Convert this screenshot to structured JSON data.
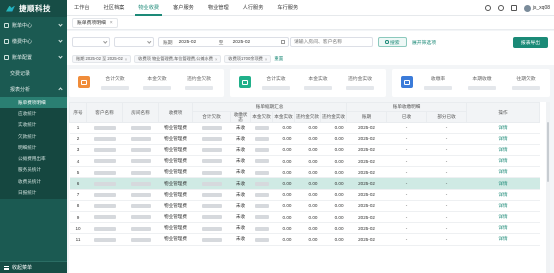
{
  "brand": {
    "name": "捷顺科技"
  },
  "sidebar": {
    "items": [
      {
        "label": "账单中心",
        "icon": "bill-icon"
      },
      {
        "label": "缴费中心",
        "icon": "payment-icon"
      },
      {
        "label": "账单配置",
        "icon": "config-icon"
      },
      {
        "label": "交费记录",
        "icon": "record-icon"
      },
      {
        "label": "报表分析",
        "icon": "report-icon"
      }
    ],
    "sub_items": [
      "账单费项明细",
      "应收统计",
      "实收统计",
      "欠款统计",
      "明细统计",
      "公摊费用出率",
      "服务员统计",
      "收费员统计",
      "日报统计"
    ],
    "footer": "收起菜单"
  },
  "topnav": {
    "tabs": [
      "工作台",
      "社区档案",
      "物业收费",
      "客户服务",
      "物业管理",
      "人行服务",
      "车行服务"
    ],
    "active": "物业收费",
    "user": "js_xq08"
  },
  "pagetab": {
    "label": "账单费项明细"
  },
  "filter": {
    "select1": "",
    "date_label": "账期",
    "date_from": "2025-02",
    "date_sep": "至",
    "date_to": "2025-02",
    "search_placeholder": "请输入房间、客户名称",
    "search_label": "搜索",
    "toggle_label": "展开筛选项",
    "export_label": "报表导出"
  },
  "chips": [
    "账期 2025-02 至 2025-02",
    "收费项 物业管理费,车位管理费,公摊水费",
    "收费项1700余项费"
  ],
  "chips_clear": "重置",
  "cards": [
    {
      "icon": "receivable-icon",
      "color": "#f08c3a",
      "stats": [
        "合计欠款",
        "本金欠款",
        "违约金欠款"
      ]
    },
    {
      "icon": "received-icon",
      "color": "#20b08a",
      "stats": [
        "合计实收",
        "本金实收",
        "违约金实收"
      ]
    },
    {
      "icon": "collect-icon",
      "color": "#3b7bd9",
      "stats": [
        "收缴率",
        "本期收缴",
        "往期欠款"
      ]
    }
  ],
  "table": {
    "headers": {
      "index": "序号",
      "customer": "客户名称",
      "room": "房间名称",
      "item": "收费项",
      "group_summary": "账单缩期汇总",
      "total_due": "合计欠款",
      "status": "收缴状态",
      "principal_due": "本金欠款",
      "principal_paid": "本金实收",
      "penalty_due": "违约金欠款",
      "penalty_paid": "违约金实收",
      "group_detail": "账单收缴明细",
      "period": "账期",
      "paid": "已收",
      "partial": "部分已收",
      "action": "操作"
    },
    "rows": [
      {
        "index": "1",
        "item": "物业管理费",
        "status": "未收",
        "v1": "0.00",
        "v2": "0.00",
        "v3": "0.00",
        "period": "2025-02",
        "paid": "-",
        "partial": "-",
        "action": "详情"
      },
      {
        "index": "2",
        "item": "物业管理费",
        "status": "未收",
        "v1": "0.00",
        "v2": "0.00",
        "v3": "0.00",
        "period": "2025-02",
        "paid": "-",
        "partial": "-",
        "action": "详情"
      },
      {
        "index": "3",
        "item": "物业管理费",
        "status": "未收",
        "v1": "0.00",
        "v2": "0.00",
        "v3": "0.00",
        "period": "2025-02",
        "paid": "-",
        "partial": "-",
        "action": "详情"
      },
      {
        "index": "4",
        "item": "物业管理费",
        "status": "未收",
        "v1": "0.00",
        "v2": "0.00",
        "v3": "0.00",
        "period": "2025-02",
        "paid": "-",
        "partial": "-",
        "action": "详情"
      },
      {
        "index": "5",
        "item": "物业管理费",
        "status": "未收",
        "v1": "0.00",
        "v2": "0.00",
        "v3": "0.00",
        "period": "2025-02",
        "paid": "-",
        "partial": "-",
        "action": "详情"
      },
      {
        "index": "6",
        "item": "物业管理费",
        "status": "未收",
        "v1": "0.00",
        "v2": "0.00",
        "v3": "0.00",
        "period": "2025-02",
        "paid": "-",
        "partial": "-",
        "action": "详情"
      },
      {
        "index": "7",
        "item": "物业管理费",
        "status": "未收",
        "v1": "0.00",
        "v2": "0.00",
        "v3": "0.00",
        "period": "2025-02",
        "paid": "-",
        "partial": "-",
        "action": "详情"
      },
      {
        "index": "8",
        "item": "物业管理费",
        "status": "未收",
        "v1": "0.00",
        "v2": "0.00",
        "v3": "0.00",
        "period": "2025-02",
        "paid": "-",
        "partial": "-",
        "action": "详情"
      },
      {
        "index": "9",
        "item": "物业管理费",
        "status": "未收",
        "v1": "0.00",
        "v2": "0.00",
        "v3": "0.00",
        "period": "2025-02",
        "paid": "-",
        "partial": "-",
        "action": "详情"
      },
      {
        "index": "10",
        "item": "物业管理费",
        "status": "未收",
        "v1": "0.00",
        "v2": "0.00",
        "v3": "0.00",
        "period": "2025-02",
        "paid": "-",
        "partial": "-",
        "action": "详情"
      },
      {
        "index": "11",
        "item": "物业管理费",
        "status": "未收",
        "v1": "0.00",
        "v2": "0.00",
        "v3": "0.00",
        "period": "2025-02",
        "paid": "-",
        "partial": "-",
        "action": "详情"
      }
    ],
    "selected_row": 6
  },
  "colors": {
    "primary": "#1d8a78",
    "sidebar": "#1b5a52",
    "selected_row": "#cfeae4"
  }
}
